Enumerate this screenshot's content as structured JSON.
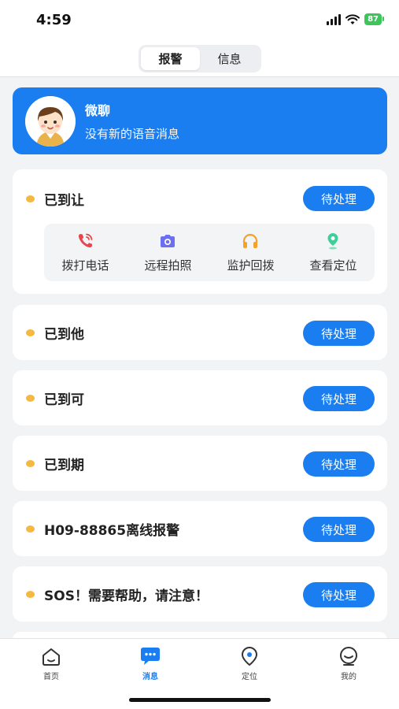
{
  "status": {
    "time": "4:59",
    "battery": "87"
  },
  "segment": {
    "tabs": [
      "报警",
      "信息"
    ],
    "active": 0
  },
  "banner": {
    "title": "微聊",
    "subtitle": "没有新的语音消息"
  },
  "alerts": [
    {
      "title": "已到让",
      "button": "待处理"
    },
    {
      "title": "已到他",
      "button": "待处理"
    },
    {
      "title": "已到可",
      "button": "待处理"
    },
    {
      "title": "已到期",
      "button": "待处理"
    },
    {
      "title": "H09-88865离线报警",
      "button": "待处理"
    },
    {
      "title": "SOS！需要帮助，请注意！",
      "button": "待处理"
    }
  ],
  "actions": [
    {
      "label": "拨打电话",
      "icon": "phone-icon"
    },
    {
      "label": "远程拍照",
      "icon": "camera-icon"
    },
    {
      "label": "监护回拨",
      "icon": "headset-icon"
    },
    {
      "label": "查看定位",
      "icon": "location-pin-icon"
    }
  ],
  "tabbar": {
    "items": [
      {
        "label": "首页",
        "icon": "home-icon"
      },
      {
        "label": "消息",
        "icon": "chat-icon"
      },
      {
        "label": "定位",
        "icon": "location-icon"
      },
      {
        "label": "我的",
        "icon": "profile-icon"
      }
    ],
    "active": 1
  },
  "colors": {
    "accent": "#1a7df0",
    "dot": "#f5b942",
    "battery": "#3cc65a"
  }
}
